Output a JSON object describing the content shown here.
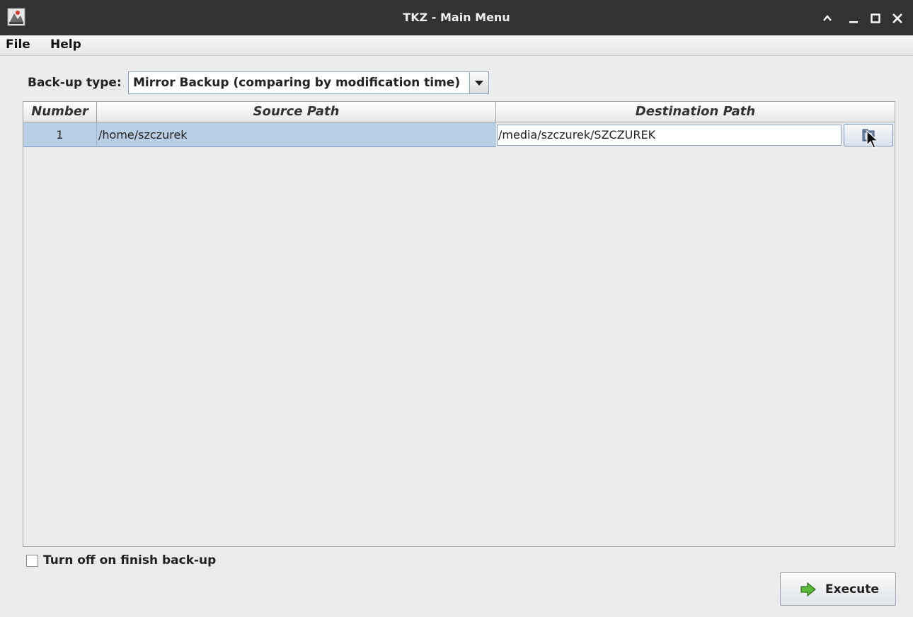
{
  "window": {
    "title": "TKZ - Main Menu",
    "controls": [
      "chevron-up-icon",
      "minimize-icon",
      "maximize-icon",
      "close-icon"
    ]
  },
  "menu": {
    "items": [
      {
        "label": "File"
      },
      {
        "label": "Help"
      }
    ]
  },
  "backup": {
    "type_label": "Back-up type:",
    "type_selected": "Mirror Backup (comparing by modification time)"
  },
  "table": {
    "columns": [
      "Number",
      "Source Path",
      "Destination Path"
    ],
    "rows": [
      {
        "number": "1",
        "source": "/home/szczurek",
        "destination": "/media/szczurek/SZCZUREK"
      }
    ]
  },
  "options": {
    "turn_off_label": "Turn off on finish back-up",
    "turn_off_checked": false
  },
  "actions": {
    "execute_label": "Execute"
  },
  "colors": {
    "titlebar": "#323232",
    "selection": "#b8cfe5",
    "accent": "#4a9a2e"
  }
}
